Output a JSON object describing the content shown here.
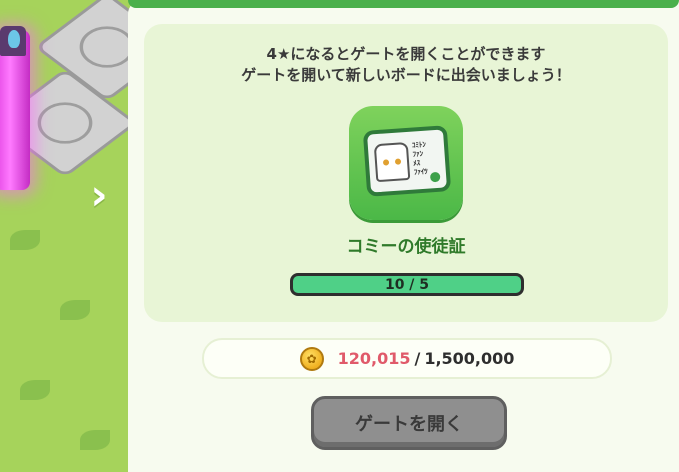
{
  "background": {
    "next_arrow": "›"
  },
  "gate_panel": {
    "description_line1": "4★になるとゲートを開くことができます",
    "description_line2": "ゲートを開いて新しいボードに出会いましょう！",
    "item": {
      "name": "コミーの使徒証",
      "icon": "id-card-icon",
      "card_text": [
        "ｺﾐﾄﾝ",
        "ﾌｧﾝ",
        "ﾒｽ",
        "ﾌｧｲﾂ"
      ]
    },
    "progress": {
      "text": "10 / 5",
      "fill_fraction": 1.0,
      "fill_color": "#4fd087"
    },
    "cost": {
      "icon": "coin-icon",
      "current": "120,015",
      "separator": "/",
      "total": "1,500,000",
      "current_color": "#e05a6a"
    },
    "open_button_label": "ゲートを開く"
  },
  "colors": {
    "panel_accent": "#4bb04b",
    "card_bg": "#e8f5d6",
    "button_disabled": "#8f8f8f"
  }
}
